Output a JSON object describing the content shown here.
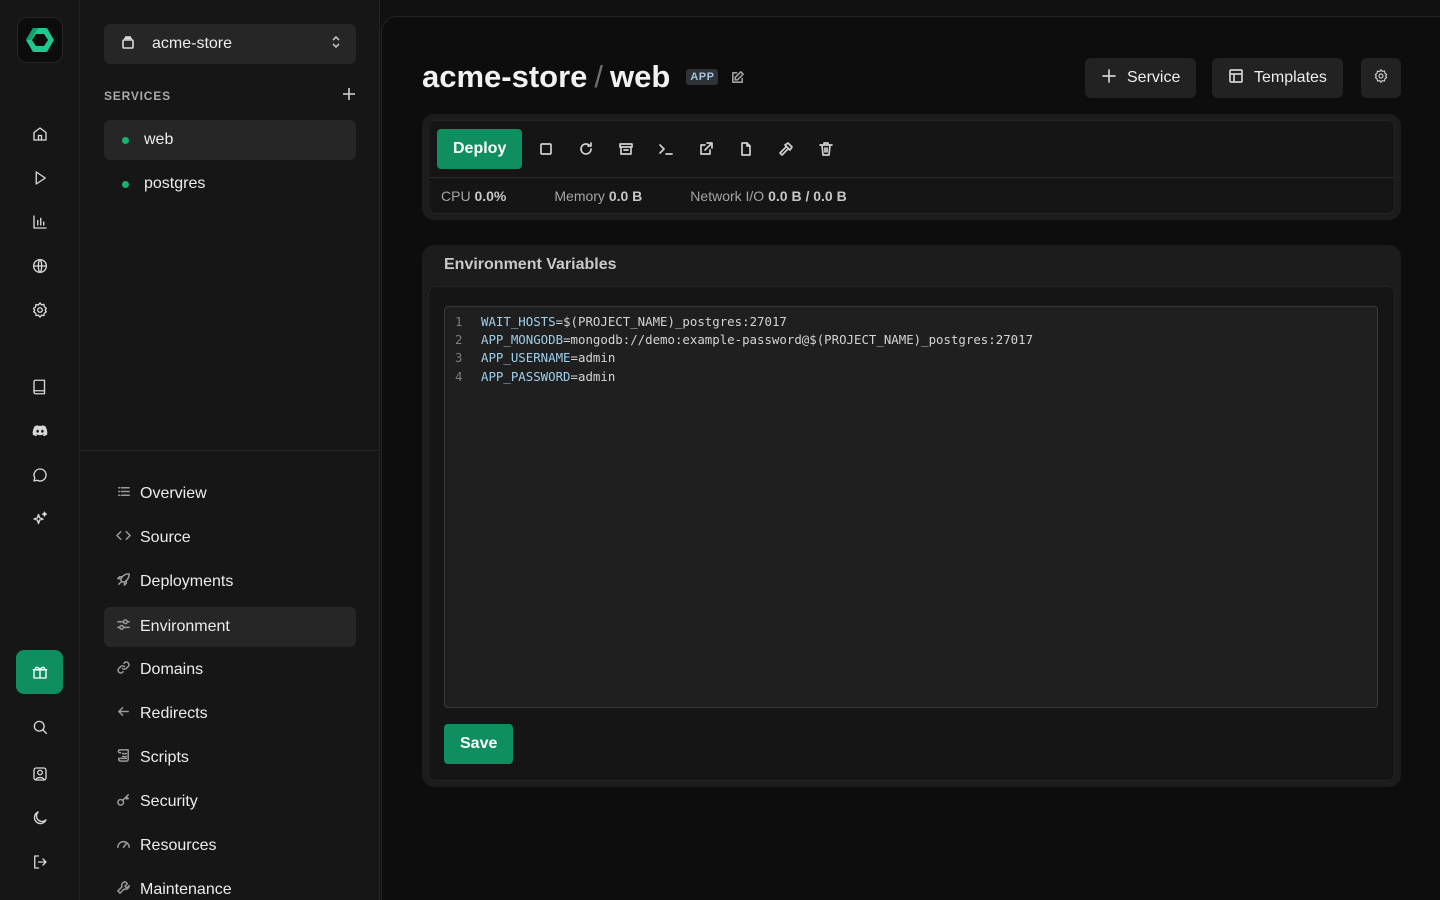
{
  "colors": {
    "accent": "#0f8f5f",
    "status_dot": "#17b36b",
    "env_key": "#9fd0ec"
  },
  "rail": {
    "logo": "logo-icon",
    "top_icons": [
      "home-icon",
      "play-icon",
      "bar-chart-icon",
      "globe-icon",
      "settings-icon"
    ],
    "mid_icons": [
      "book-icon",
      "discord-icon",
      "chat-icon",
      "sparkles-icon"
    ],
    "bottom_icons": [
      "gift-icon",
      "search-icon",
      "user-icon",
      "moon-icon",
      "logout-icon"
    ]
  },
  "sidebar": {
    "project": "acme-store",
    "services_label": "SERVICES",
    "services": [
      {
        "name": "web",
        "active": true
      },
      {
        "name": "postgres",
        "active": false
      }
    ],
    "nav": [
      {
        "label": "Overview",
        "icon": "list-icon"
      },
      {
        "label": "Source",
        "icon": "code-icon"
      },
      {
        "label": "Deployments",
        "icon": "rocket-icon"
      },
      {
        "label": "Environment",
        "icon": "sliders-icon",
        "active": true
      },
      {
        "label": "Domains",
        "icon": "link-icon"
      },
      {
        "label": "Redirects",
        "icon": "arrow-left-icon"
      },
      {
        "label": "Scripts",
        "icon": "scroll-icon"
      },
      {
        "label": "Security",
        "icon": "key-icon"
      },
      {
        "label": "Resources",
        "icon": "gauge-icon"
      },
      {
        "label": "Maintenance",
        "icon": "wrench-icon"
      }
    ]
  },
  "header": {
    "project": "acme-store",
    "separator": "/",
    "service": "web",
    "badge": "APP",
    "service_button": "Service",
    "templates_button": "Templates"
  },
  "deploy": {
    "deploy_label": "Deploy",
    "tools": [
      "stop-icon",
      "restart-icon",
      "archive-icon",
      "terminal-icon",
      "external-link-icon",
      "file-icon",
      "hammer-icon",
      "trash-icon"
    ],
    "stats": {
      "cpu_label": "CPU",
      "cpu_value": "0.0%",
      "memory_label": "Memory",
      "memory_value": "0.0 B",
      "network_label": "Network I/O",
      "network_value": "0.0 B / 0.0 B"
    }
  },
  "env": {
    "title": "Environment Variables",
    "lines": [
      {
        "num": "1",
        "key": "WAIT_HOSTS",
        "value": "=$(PROJECT_NAME)_postgres:27017"
      },
      {
        "num": "2",
        "key": "APP_MONGODB",
        "value": "=mongodb://demo:example-password@$(PROJECT_NAME)_postgres:27017"
      },
      {
        "num": "3",
        "key": "APP_USERNAME",
        "value": "=admin"
      },
      {
        "num": "4",
        "key": "APP_PASSWORD",
        "value": "=admin"
      }
    ],
    "save_label": "Save"
  }
}
